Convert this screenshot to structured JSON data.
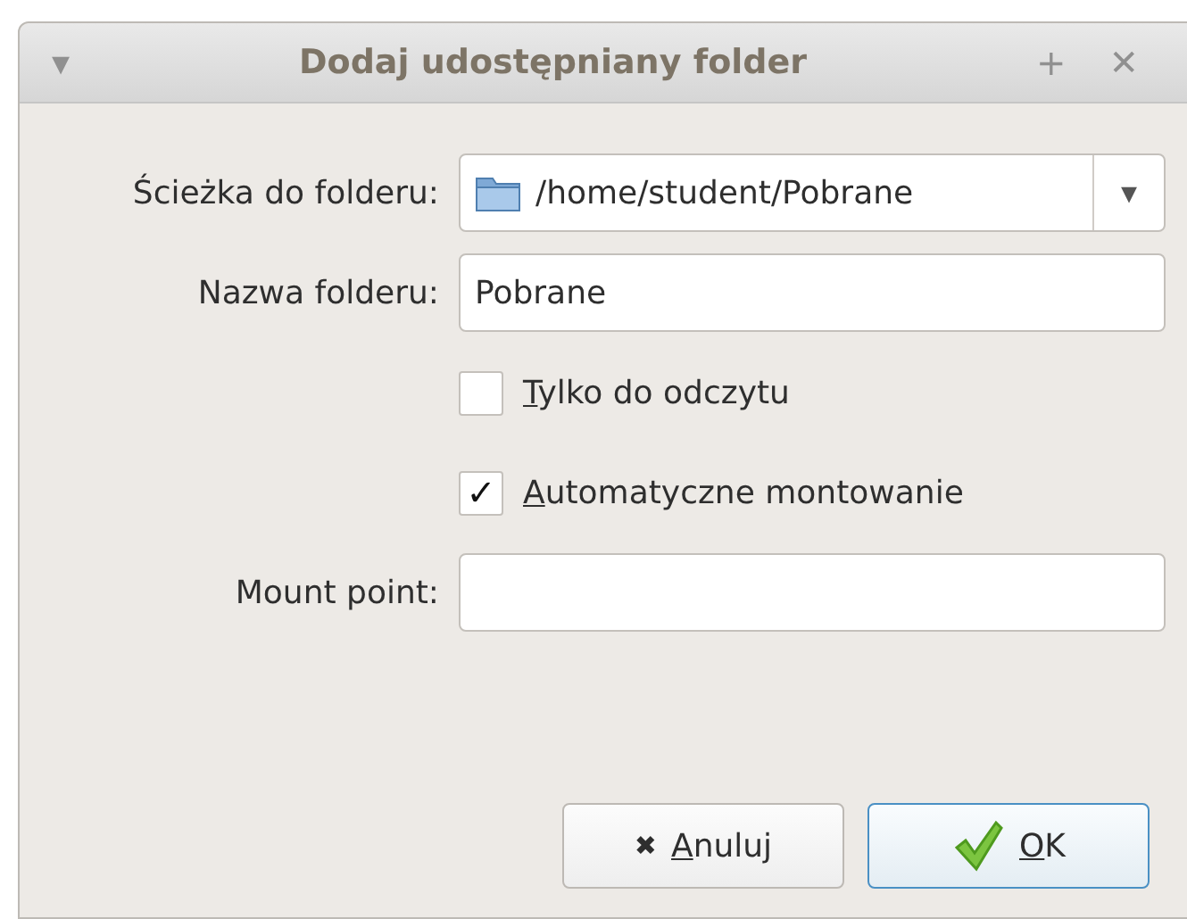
{
  "window": {
    "title": "Dodaj udostępniany folder",
    "menu_glyph": "▾",
    "buttons": [
      "+",
      "✕"
    ]
  },
  "fields": [
    {
      "kind": "combo",
      "label": "Ścieżka do folderu:",
      "value": "/home/student/Pobrane",
      "glyph": "▾"
    },
    {
      "kind": "text",
      "label": "Nazwa folderu:",
      "value": "Pobrane"
    },
    {
      "kind": "check",
      "label": "Tylko do odczytu",
      "mnemonic": true,
      "checked": false
    },
    {
      "kind": "check",
      "label": "Automatyczne montowanie",
      "mnemonic": true,
      "checked": true
    },
    {
      "kind": "text",
      "label": "Mount point:"
    }
  ],
  "check_glyph": "✓",
  "actions": [
    {
      "kind": "cancel",
      "label": "Anuluj",
      "mnemonic": true,
      "default": false,
      "glyph": "✖"
    },
    {
      "kind": "ok",
      "label": "OK",
      "mnemonic": true,
      "default": true
    }
  ]
}
